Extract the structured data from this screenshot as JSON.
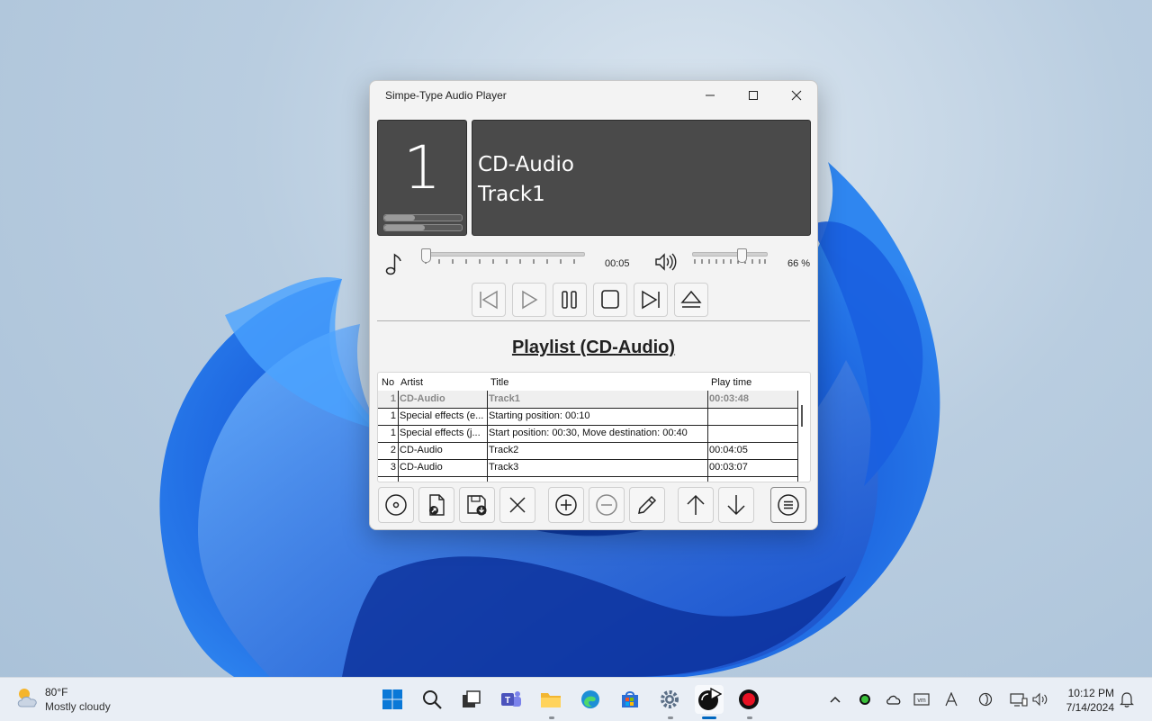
{
  "window": {
    "title": "Simpe-Type Audio Player",
    "track_number": "1",
    "info_line1": "CD-Audio",
    "info_line2": "Track1",
    "elapsed": "00:05",
    "volume": "66 %",
    "volume_level": 0.66,
    "playlist_title": "Playlist (CD-Audio)"
  },
  "table": {
    "headers": {
      "no": "No",
      "artist": "Artist",
      "title": "Title",
      "time": "Play time"
    },
    "rows": [
      {
        "no": "1",
        "artist": "CD-Audio",
        "title": "Track1",
        "time": "00:03:48"
      },
      {
        "no": "1",
        "artist": "Special effects (e...",
        "title": "Starting position: 00:10",
        "time": ""
      },
      {
        "no": "1",
        "artist": "Special effects (j...",
        "title": "Start position: 00:30, Move destination: 00:40",
        "time": ""
      },
      {
        "no": "2",
        "artist": "CD-Audio",
        "title": "Track2",
        "time": "00:04:05"
      },
      {
        "no": "3",
        "artist": "CD-Audio",
        "title": "Track3",
        "time": "00:03:07"
      }
    ]
  },
  "taskbar": {
    "weather_temp": "80°F",
    "weather_cond": "Mostly cloudy",
    "time": "10:12 PM",
    "date": "7/14/2024"
  },
  "colors": {
    "accent": "#0067c0",
    "display_bg": "#4a4a4a",
    "record": "#e81123"
  }
}
